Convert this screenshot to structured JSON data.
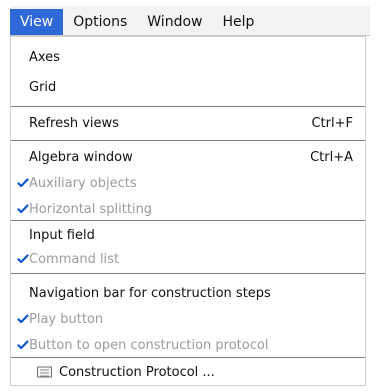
{
  "menubar": {
    "items": [
      {
        "label": "View",
        "active": true
      },
      {
        "label": "Options",
        "active": false
      },
      {
        "label": "Window",
        "active": false
      },
      {
        "label": "Help",
        "active": false
      }
    ]
  },
  "menu": {
    "items": [
      {
        "label": "Axes",
        "enabled": true,
        "checked": false
      },
      {
        "label": "Grid",
        "enabled": true,
        "checked": false
      },
      {
        "label": "Refresh views",
        "shortcut": "Ctrl+F",
        "enabled": true,
        "checked": false
      },
      {
        "label": "Algebra window",
        "shortcut": "Ctrl+A",
        "enabled": true,
        "checked": false
      },
      {
        "label": "Auxiliary objects",
        "enabled": false,
        "checked": true
      },
      {
        "label": "Horizontal splitting",
        "enabled": false,
        "checked": true
      },
      {
        "label": "Input field",
        "enabled": true,
        "checked": false
      },
      {
        "label": "Command list",
        "enabled": false,
        "checked": true
      },
      {
        "label": "Navigation bar for construction steps",
        "enabled": true,
        "checked": false
      },
      {
        "label": "Play button",
        "enabled": false,
        "checked": true
      },
      {
        "label": "Button to open construction protocol",
        "enabled": false,
        "checked": true
      },
      {
        "label": "Construction Protocol ...",
        "enabled": true,
        "checked": false
      }
    ]
  },
  "colors": {
    "accent": "#2f68d7",
    "disabled_text": "#9b9b9b",
    "menu_bg": "#ffffff"
  },
  "icons": {
    "check": "checkmark-icon",
    "protocol": "window-icon"
  }
}
